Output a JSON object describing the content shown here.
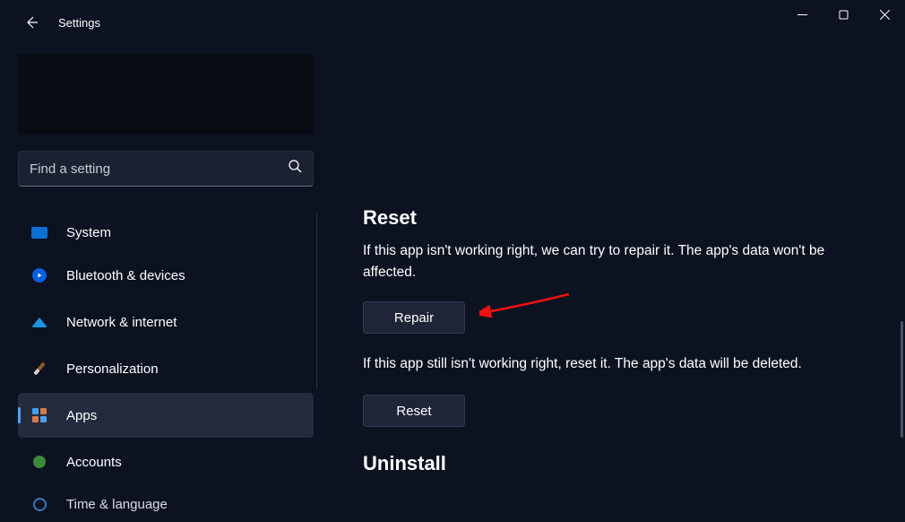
{
  "titlebar": {
    "app_name": "Settings"
  },
  "search": {
    "placeholder": "Find a setting"
  },
  "nav": {
    "items": [
      {
        "label": "System"
      },
      {
        "label": "Bluetooth & devices"
      },
      {
        "label": "Network & internet"
      },
      {
        "label": "Personalization"
      },
      {
        "label": "Apps"
      },
      {
        "label": "Accounts"
      },
      {
        "label": "Time & language"
      }
    ]
  },
  "content": {
    "reset_heading": "Reset",
    "repair_text": "If this app isn't working right, we can try to repair it. The app's data won't be affected.",
    "repair_button": "Repair",
    "reset_text": "If this app still isn't working right, reset it. The app's data will be deleted.",
    "reset_button": "Reset",
    "uninstall_heading": "Uninstall"
  }
}
